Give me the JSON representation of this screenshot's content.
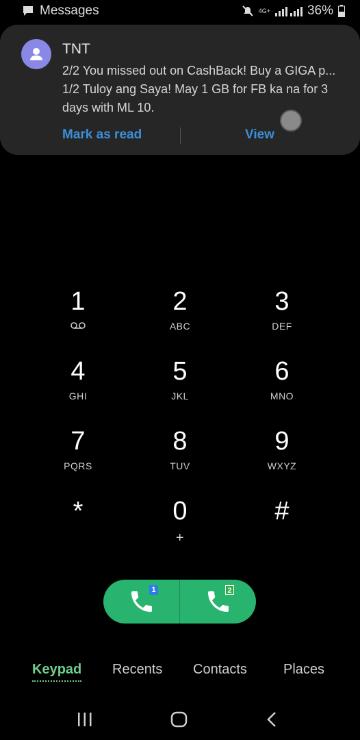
{
  "status_bar": {
    "app_name": "Messages",
    "network": "4G+",
    "battery_percent": "36%"
  },
  "notification": {
    "sender": "TNT",
    "lines": [
      "2/2 You missed out on CashBack! Buy a GIGA p...",
      "1/2 Tuloy ang Saya! May 1 GB for FB ka na for 3",
      "days with ML 10."
    ],
    "action_mark_read": "Mark as read",
    "action_view": "View"
  },
  "keypad": {
    "k1": {
      "digit": "1",
      "letters": ""
    },
    "k2": {
      "digit": "2",
      "letters": "ABC"
    },
    "k3": {
      "digit": "3",
      "letters": "DEF"
    },
    "k4": {
      "digit": "4",
      "letters": "GHI"
    },
    "k5": {
      "digit": "5",
      "letters": "JKL"
    },
    "k6": {
      "digit": "6",
      "letters": "MNO"
    },
    "k7": {
      "digit": "7",
      "letters": "PQRS"
    },
    "k8": {
      "digit": "8",
      "letters": "TUV"
    },
    "k9": {
      "digit": "9",
      "letters": "WXYZ"
    },
    "kstar": {
      "digit": "*",
      "letters": ""
    },
    "k0": {
      "digit": "0",
      "letters": "+"
    },
    "khash": {
      "digit": "#",
      "letters": ""
    }
  },
  "call": {
    "sim1_label": "1",
    "sim2_label": "2",
    "accent": "#28b46e"
  },
  "tabs": {
    "keypad": "Keypad",
    "recents": "Recents",
    "contacts": "Contacts",
    "places": "Places"
  },
  "colors": {
    "link": "#3b8fd9",
    "active_tab": "#6fcf8c",
    "avatar": "#8a88e6"
  }
}
